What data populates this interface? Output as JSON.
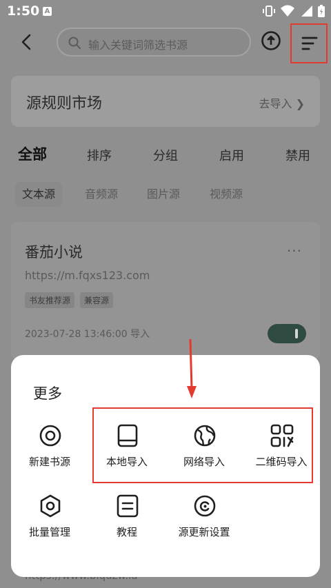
{
  "status_bar": {
    "time": "1:50",
    "a_badge": "A"
  },
  "toolbar": {
    "search_placeholder": "输入关键词筛选书源"
  },
  "market": {
    "title": "源规则市场",
    "go_label": "去导入"
  },
  "tabs": [
    "全部",
    "排序",
    "分组",
    "启用",
    "禁用"
  ],
  "chips": [
    "文本源",
    "音频源",
    "图片源",
    "视频源"
  ],
  "card": {
    "name": "番茄小说",
    "url": "https://m.fqxs123.com",
    "tags": [
      "书友推荐源",
      "兼容源"
    ],
    "date": "2023-07-28 13:46:00 导入",
    "more": "···",
    "enabled": true
  },
  "background_url": "https://www.biquzw.la",
  "sheet": {
    "title": "更多",
    "items": [
      {
        "label": "新建书源",
        "icon": "circle-target-icon"
      },
      {
        "label": "本地导入",
        "icon": "book-icon"
      },
      {
        "label": "网络导入",
        "icon": "globe-icon"
      },
      {
        "label": "二维码导入",
        "icon": "qr-code-icon"
      },
      {
        "label": "批量管理",
        "icon": "hexagon-settings-icon"
      },
      {
        "label": "教程",
        "icon": "document-icon"
      },
      {
        "label": "源更新设置",
        "icon": "refresh-circle-icon"
      }
    ]
  },
  "annotation_color": "#e23a2f"
}
